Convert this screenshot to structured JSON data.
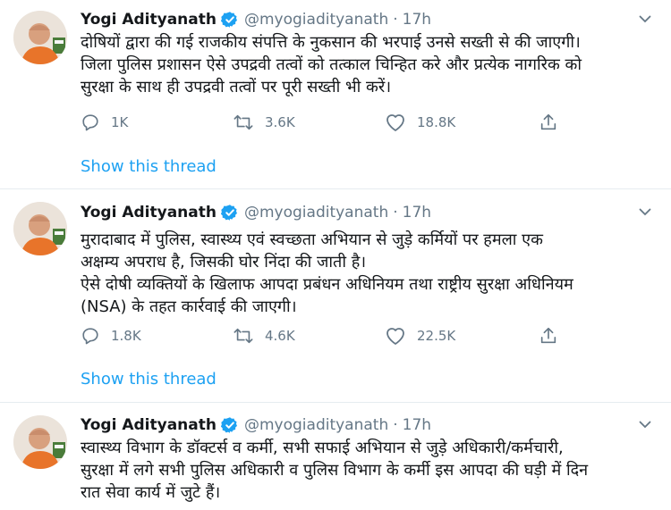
{
  "tweets": [
    {
      "author": {
        "name": "Yogi Adityanath",
        "handle": "@myogiadityanath",
        "time": "17h"
      },
      "text": [
        "दोषियों द्वारा की गई राजकीय संपत्ति के नुकसान की भरपाई उनसे सख्ती से की जाएगी।",
        "जिला पुलिस प्रशासन ऐसे उपद्रवी तत्वों को तत्काल चिन्हित करे और प्रत्येक नागरिक को",
        "सुरक्षा के साथ ही उपद्रवी तत्वों पर पूरी सख्ती भी करें।"
      ],
      "replies": "1K",
      "retweets": "3.6K",
      "likes": "18.8K",
      "thread_link": "Show this thread"
    },
    {
      "author": {
        "name": "Yogi Adityanath",
        "handle": "@myogiadityanath",
        "time": "17h"
      },
      "text": [
        "मुरादाबाद में पुलिस, स्वास्थ्य एवं स्वच्छता अभियान से जुड़े कर्मियों पर हमला एक",
        "अक्षम्य अपराध है, जिसकी घोर निंदा की जाती है।",
        "ऐसे दोषी व्यक्तियों के खिलाफ आपदा प्रबंधन अधिनियम तथा राष्ट्रीय सुरक्षा अधिनियम",
        "(NSA) के तहत कार्रवाई की जाएगी।"
      ],
      "replies": "1.8K",
      "retweets": "4.6K",
      "likes": "22.5K",
      "thread_link": "Show this thread"
    },
    {
      "author": {
        "name": "Yogi Adityanath",
        "handle": "@myogiadityanath",
        "time": "17h"
      },
      "text": [
        "स्वास्थ्य विभाग के डॉक्टर्स व कर्मी, सभी सफाई अभियान से जुड़े अधिकारी/कर्मचारी,",
        "सुरक्षा में लगे सभी पुलिस अधिकारी व पुलिस विभाग के कर्मी इस आपदा की घड़ी में दिन",
        "रात सेवा कार्य में जुटे हैं।"
      ]
    }
  ],
  "colors": {
    "link": "#1da1f2",
    "secondary_text": "#657786",
    "primary_text": "#14171a",
    "divider": "#e6ecf0",
    "verified_badge": "#1da1f2"
  },
  "icons": {
    "reply": "reply-icon",
    "retweet": "retweet-icon",
    "like": "heart-icon",
    "share": "share-icon",
    "more": "chevron-down-icon",
    "verified": "verified-badge-icon"
  }
}
